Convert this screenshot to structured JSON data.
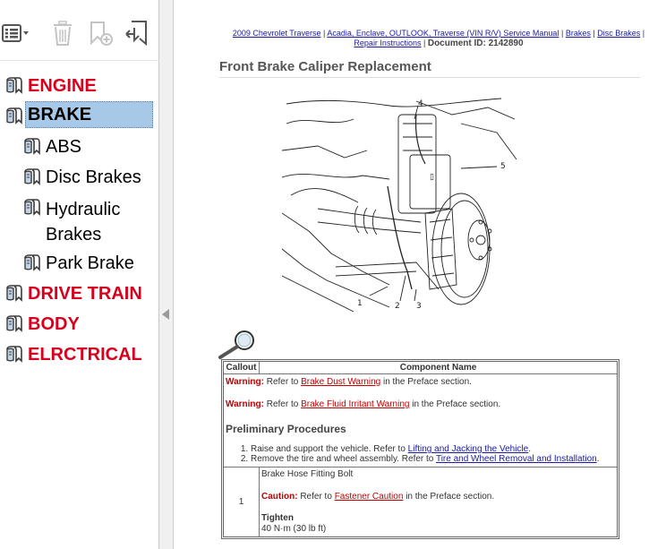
{
  "sidebar": {
    "toolbar": {
      "options_icon": "options-list-icon",
      "delete_icon": "trash-icon",
      "new_bookmark_icon": "bookmark-add-icon",
      "expand_icon": "bookmark-expand-icon"
    },
    "bookmarks": [
      {
        "label": "ENGINE",
        "level": 0
      },
      {
        "label": "BRAKE",
        "level": 0,
        "selected": true
      },
      {
        "label": "ABS",
        "level": 1
      },
      {
        "label": "Disc Brakes",
        "level": 1
      },
      {
        "label": "Hydraulic",
        "label2": "Brakes",
        "level": 1
      },
      {
        "label": "Park Brake",
        "level": 1
      },
      {
        "label": "DRIVE TRAIN",
        "level": 0
      },
      {
        "label": "BODY",
        "level": 0
      },
      {
        "label": "ELRCTRICAL",
        "level": 0
      }
    ]
  },
  "doc": {
    "crumbs": {
      "c1": "2009 Chevrolet Traverse",
      "c2": "Acadia, Enclave, OUTLOOK, Traverse (VIN R/V) Service Manual",
      "c3": "Brakes",
      "c4": "Disc Brakes",
      "c5": "Repair Instructions",
      "sep": "|",
      "docid": "Document ID: 2142890"
    },
    "title": "Front Brake Caliper Replacement",
    "diagram_callouts": [
      "1",
      "2",
      "3",
      "4",
      "5"
    ],
    "table": {
      "col_callout": "Callout",
      "col_component": "Component Name",
      "warn1": {
        "prefix": "Warning:",
        "pre": "Refer to",
        "link": "Brake Dust Warning",
        "post": "in the Preface section."
      },
      "warn2": {
        "prefix": "Warning:",
        "pre": "Refer to",
        "link": "Brake Fluid Irritant Warning",
        "post": "in the Preface section."
      },
      "prelim_heading": "Preliminary Procedures",
      "step1": {
        "text": "Raise and support the vehicle. Refer to",
        "link": "Lifting and Jacking the Vehicle",
        "end": "."
      },
      "step2": {
        "text": "Remove the tire and wheel assembly. Refer to",
        "link": "Tire and Wheel Removal and Installation",
        "end": "."
      },
      "row1": {
        "callout": "1",
        "name": "Brake Hose Fitting Bolt",
        "caution_prefix": "Caution:",
        "caution_pre": "Refer to",
        "caution_link": "Fastener Caution",
        "caution_post": "in the Preface section.",
        "tighten_label": "Tighten",
        "tighten_value": "40 N·m (30 lb ft)"
      }
    }
  }
}
